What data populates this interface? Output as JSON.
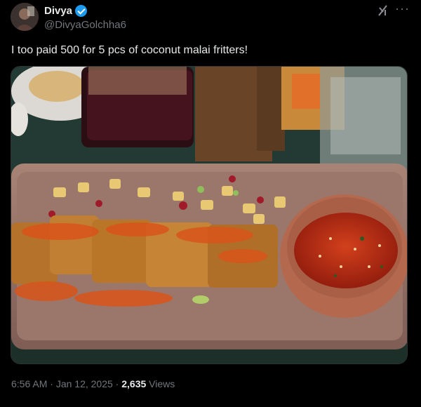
{
  "author": {
    "name": "Divya",
    "handle": "@DivyaGolchha6"
  },
  "tweet": {
    "text": "I too paid 500 for 5 pcs of coconut malai fritters!"
  },
  "meta": {
    "time": "6:56 AM",
    "separator1": " · ",
    "date": "Jan 12, 2025",
    "separator2": " · ",
    "views_count": "2,635",
    "views_label": " Views"
  },
  "icons": {
    "verified": "verified-badge-icon",
    "grok": "grok-icon",
    "more": "more-icon"
  },
  "colors": {
    "background": "#000000",
    "text": "#e7e9ea",
    "muted": "#71767b",
    "verified": "#1d9bf0"
  }
}
